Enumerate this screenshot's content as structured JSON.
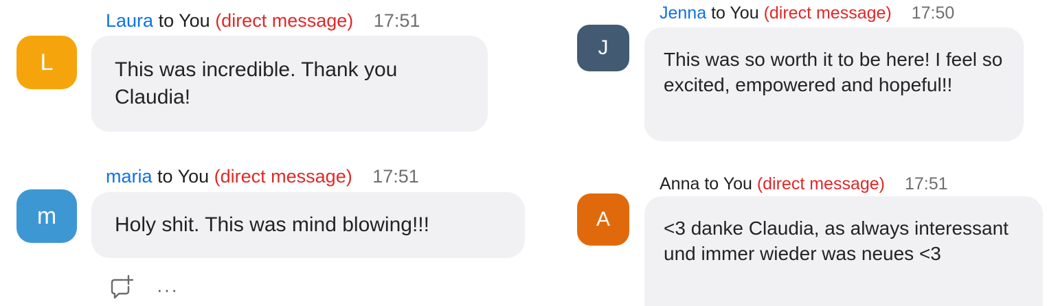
{
  "messages": [
    {
      "sender": "Laura",
      "to": "to You",
      "dm": "(direct message)",
      "time": "17:51",
      "avatar_letter": "L",
      "avatar_color": "#f5a50b",
      "text": "This was incredible. Thank you Claudia!"
    },
    {
      "sender": "maria",
      "to": "to You",
      "dm": "(direct message)",
      "time": "17:51",
      "avatar_letter": "m",
      "avatar_color": "#3d97d3",
      "text": "Holy shit. This was mind blowing!!!"
    },
    {
      "sender": "Jenna",
      "to": "to You",
      "dm": "(direct message)",
      "time": "17:50",
      "avatar_letter": "J",
      "avatar_color": "#435a73",
      "text": "This was so worth it to be here! I feel so excited, empowered and hopeful!!"
    },
    {
      "sender": "Anna",
      "to": "to You",
      "dm": "(direct message)",
      "time": "17:51",
      "avatar_letter": "A",
      "avatar_color": "#e06a0b",
      "text": "<3 danke Claudia, as always interessant und immer wieder was neues <3"
    }
  ],
  "actions": {
    "reply_icon": "reply-plus-icon",
    "more_label": "···"
  },
  "colors": {
    "sender_link": "#0e71eb",
    "direct_message": "#e02828",
    "timestamp": "#6e6e6e",
    "bubble_bg": "#f1f1f4"
  }
}
